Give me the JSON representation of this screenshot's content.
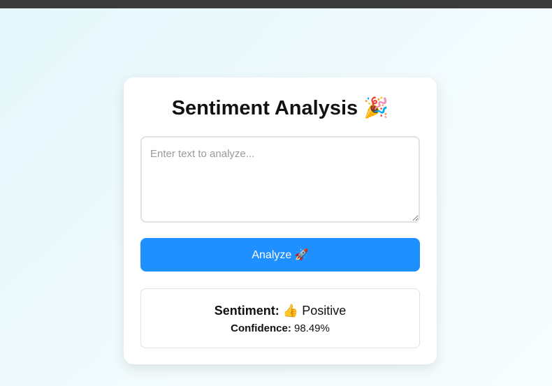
{
  "title": "Sentiment Analysis",
  "title_emoji": "🎉",
  "input": {
    "placeholder": "Enter text to analyze...",
    "value": ""
  },
  "analyze_button": {
    "label": "Analyze",
    "emoji": "🚀"
  },
  "result": {
    "sentiment_label": "Sentiment:",
    "sentiment_emoji": "👍",
    "sentiment_value": "Positive",
    "confidence_label": "Confidence:",
    "confidence_value": "98.49%"
  },
  "colors": {
    "accent": "#1e90ff",
    "topbar": "#3b3b3b",
    "background": "#e9f8fb"
  }
}
